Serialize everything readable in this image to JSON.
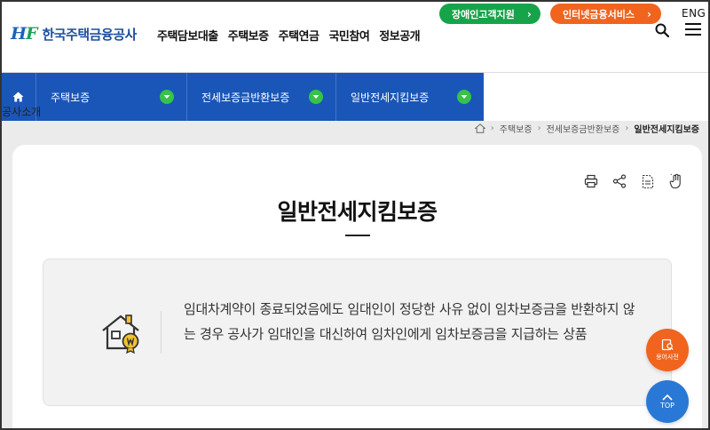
{
  "header": {
    "logo_mark_h": "H",
    "logo_mark_f": "F",
    "logo_text": "한국주택금융공사",
    "gnb": [
      "주택담보대출",
      "주택보증",
      "주택연금",
      "국민참여",
      "정보공개"
    ],
    "accessibility_button": "장애인고객지원",
    "internet_button": "인터넷금융서비스",
    "lang": "ENG"
  },
  "nav": {
    "items": [
      "주택보증",
      "전세보증금반환보증",
      "일반전세지킴보증"
    ],
    "overflow_label": "공사소개"
  },
  "breadcrumb": [
    "주택보증",
    "전세보증금반환보증",
    "일반전세지킴보증"
  ],
  "page": {
    "title": "일반전세지킴보증",
    "description": "임대차계약이 종료되었음에도 임대인이 정당한 사유 없이 임차보증금을 반환하지 않는 경우 공사가 임대인을 대신하여 임차인에게 임차보증금을 지급하는 상품"
  },
  "fab": {
    "dictionary": "용어사전",
    "top": "TOP"
  },
  "colors": {
    "brand_blue": "#1a56b7",
    "green": "#17a34a",
    "orange": "#f0641e",
    "top_button": "#2a78d6"
  }
}
